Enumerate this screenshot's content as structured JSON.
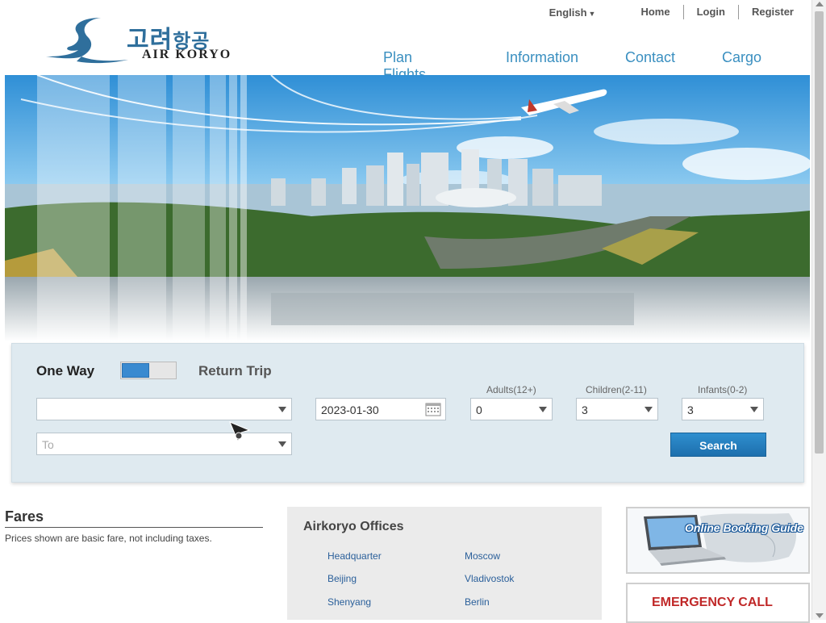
{
  "header": {
    "logo": {
      "korean": "고려",
      "korean_small": "항공",
      "english": "AIR KORYO"
    },
    "top_links": {
      "language": "English",
      "home": "Home",
      "login": "Login",
      "register": "Register"
    },
    "main_nav": [
      "Plan Flights",
      "Information",
      "Contact",
      "Cargo"
    ]
  },
  "booking": {
    "one_way_label": "One Way",
    "return_label": "Return Trip",
    "from_value": "",
    "to_placeholder": "To",
    "date_value": "2023-01-30",
    "adults_label": "Adults(12+)",
    "adults_value": "0",
    "children_label": "Children(2-11)",
    "children_value": "3",
    "infants_label": "Infants(0-2)",
    "infants_value": "3",
    "search_label": "Search"
  },
  "fares": {
    "title": "Fares",
    "note": "Prices shown are basic fare, not including taxes."
  },
  "offices": {
    "title": "Airkoryo Offices",
    "items": [
      "Headquarter",
      "Moscow",
      "Beijing",
      "Vladivostok",
      "Shenyang",
      "Berlin"
    ]
  },
  "side": {
    "guide_label": "Online Booking Guide",
    "emergency_label": "EMERGENCY CALL"
  },
  "colors": {
    "accent": "#3a8fc0",
    "button": "#1d6fad",
    "emergency": "#c02828"
  }
}
